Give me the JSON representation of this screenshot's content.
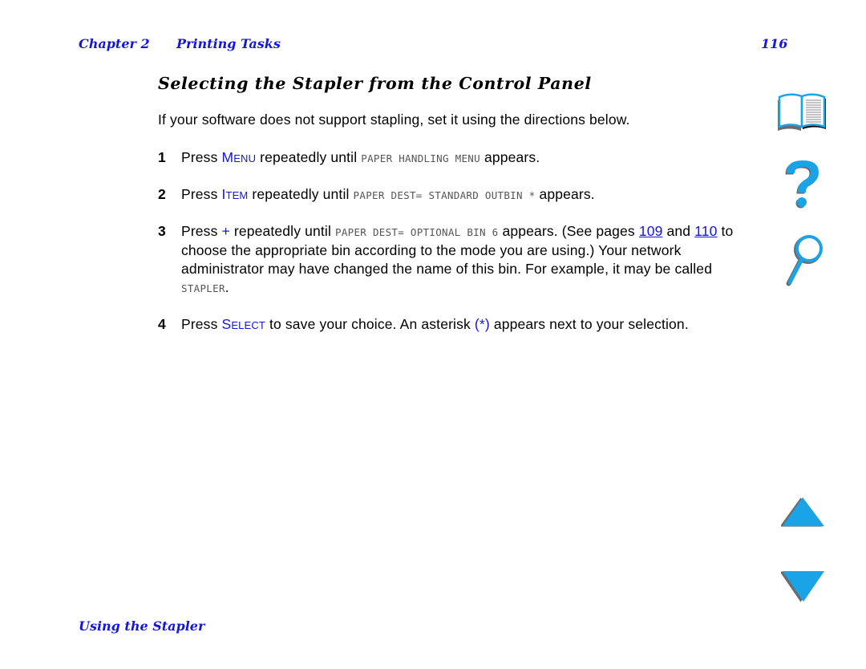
{
  "header": {
    "chapter": "Chapter 2",
    "section": "Printing Tasks",
    "page_number": "116"
  },
  "title": "Selecting the Stapler from the Control Panel",
  "intro": "If your software does not support stapling, set it using the directions below.",
  "steps": [
    {
      "num": "1",
      "pre": "Press ",
      "key_first": "M",
      "key_rest": "ENU",
      "mid": " repeatedly until ",
      "display": "PAPER HANDLING MENU",
      "post": " appears."
    },
    {
      "num": "2",
      "pre": "Press ",
      "key_first": "I",
      "key_rest": "TEM",
      "mid": " repeatedly until ",
      "display": "PAPER DEST= STANDARD OUTBIN *",
      "post": " appears."
    },
    {
      "num": "3",
      "pre": "Press ",
      "key": "+",
      "mid": " repeatedly until ",
      "display": "PAPER DEST= OPTIONAL BIN 6",
      "post": " appears. (See pages ",
      "link1": "109",
      "and": " and ",
      "link2": "110",
      "post2": " to choose the appropriate bin according to the mode you are using.) Your network administrator may have changed the name of this bin. For example, it may be called ",
      "display2": "STAPLER",
      "end": "."
    },
    {
      "num": "4",
      "pre": "Press ",
      "key_first": "S",
      "key_rest": "ELECT",
      "mid": " to save your choice. An asterisk ",
      "asterisk": "(*)",
      "post": " appears next to your selection."
    }
  ],
  "footer": {
    "section_link": "Using the Stapler"
  },
  "nav_icons": [
    "contents-book-icon",
    "help-question-icon",
    "search-magnifier-icon",
    "previous-page-arrow-icon",
    "next-page-arrow-icon"
  ],
  "colors": {
    "link_blue": "#1515e0",
    "icon_blue": "#1aa3e6",
    "icon_shadow": "#6b6b6b"
  }
}
